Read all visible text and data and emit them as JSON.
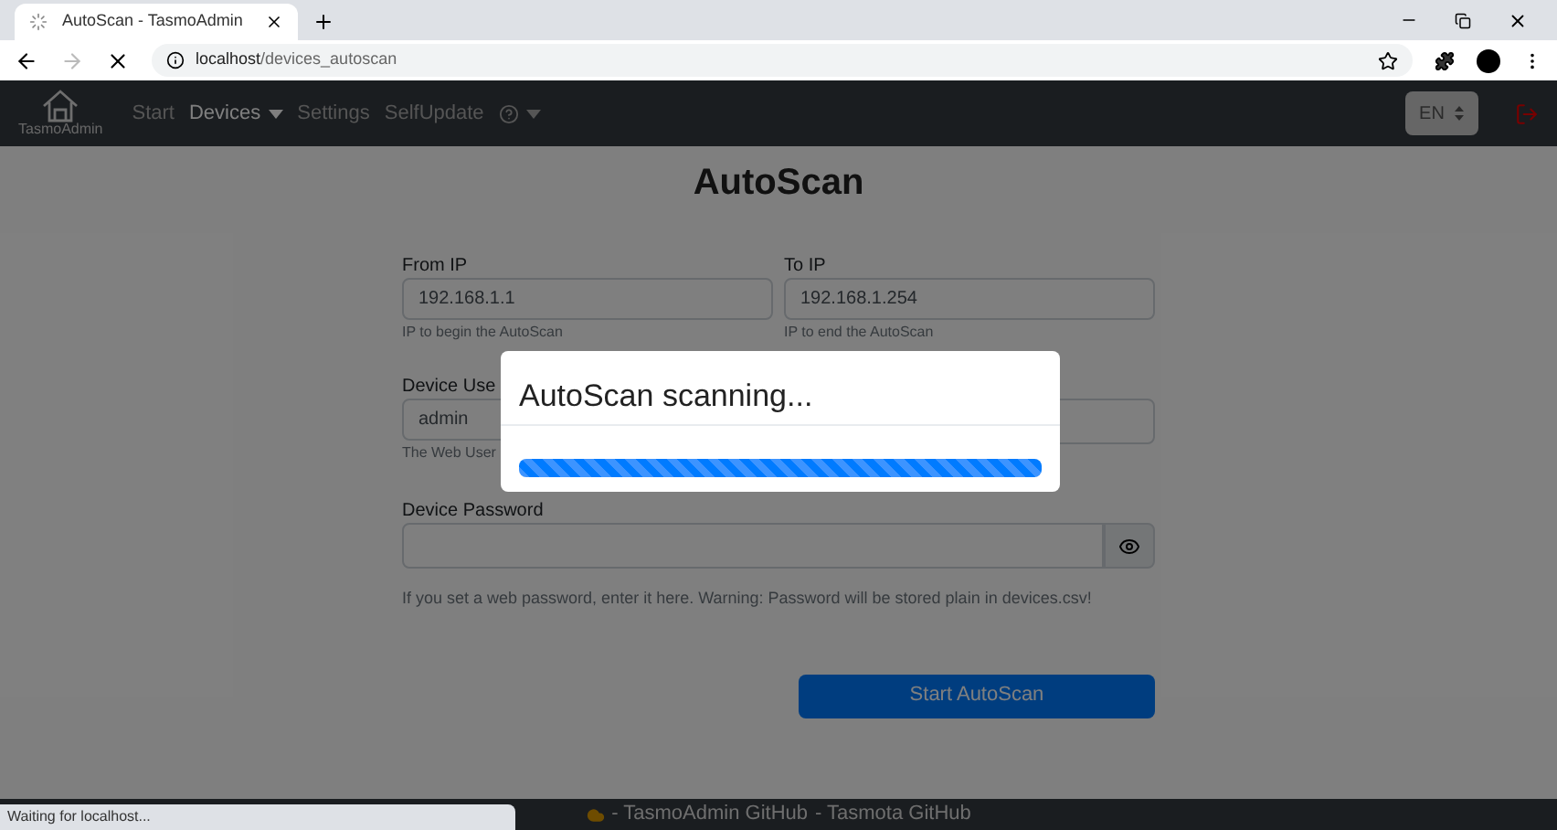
{
  "browser": {
    "tab_title": "AutoScan - TasmoAdmin",
    "url_host": "localhost",
    "url_path": "/devices_autoscan",
    "status": "Waiting for localhost..."
  },
  "navbar": {
    "brand": "TasmoAdmin",
    "items": [
      {
        "label": "Start",
        "selected": false,
        "dropdown": false
      },
      {
        "label": "Devices",
        "selected": true,
        "dropdown": true
      },
      {
        "label": "Settings",
        "selected": false,
        "dropdown": false
      },
      {
        "label": "SelfUpdate",
        "selected": false,
        "dropdown": false
      }
    ],
    "language": "EN"
  },
  "page": {
    "title": "AutoScan",
    "from_ip": {
      "label": "From IP",
      "value": "192.168.1.1",
      "help": "IP to begin the AutoScan"
    },
    "to_ip": {
      "label": "To IP",
      "value": "192.168.1.254",
      "help": "IP to end the AutoScan"
    },
    "username": {
      "label": "Device Use",
      "value": "admin",
      "help": "The Web User"
    },
    "password": {
      "label": "Device Password",
      "help": "If you set a web password, enter it here. Warning: Password will be stored plain in devices.csv!"
    },
    "submit": "Start AutoScan"
  },
  "modal": {
    "title": "AutoScan scanning...",
    "level": 1
  },
  "footer": {
    "links": [
      "- TasmoAdmin GitHub",
      "- Tasmota GitHub"
    ]
  }
}
